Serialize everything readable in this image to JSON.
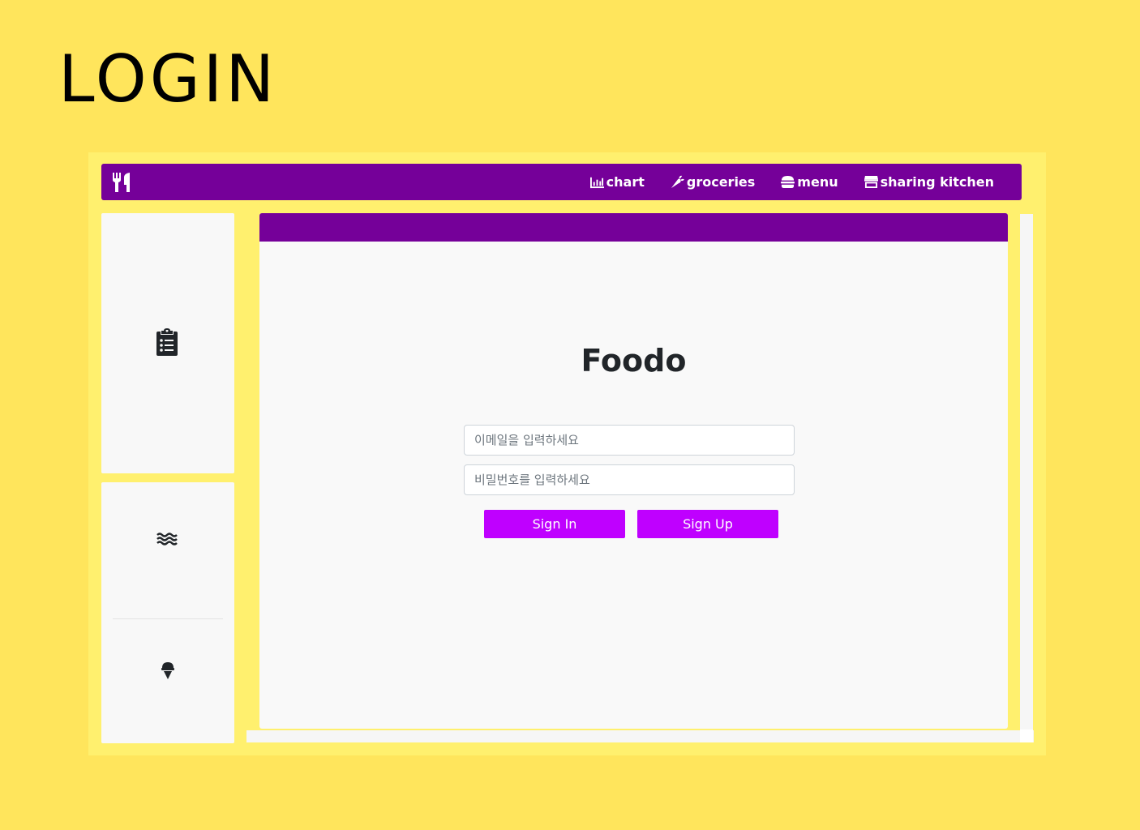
{
  "page": {
    "heading": "LOGIN"
  },
  "navbar": {
    "brand_icon": "utensils-icon",
    "links": [
      {
        "label": "chart",
        "icon": "chart-icon"
      },
      {
        "label": "groceries",
        "icon": "carrot-icon"
      },
      {
        "label": "menu",
        "icon": "burger-icon"
      },
      {
        "label": "sharing kitchen",
        "icon": "store-icon"
      }
    ]
  },
  "sidebar": {
    "items": [
      {
        "icon": "clipboard-list-icon"
      },
      {
        "icon": "water-waves-icon"
      },
      {
        "icon": "ice-cream-icon"
      }
    ]
  },
  "login": {
    "title": "Foodo",
    "email_placeholder": "이메일을 입력하세요",
    "password_placeholder": "비밀번호를 입력하세요",
    "signin_label": "Sign In",
    "signup_label": "Sign Up"
  },
  "colors": {
    "background": "#FFE55C",
    "frame": "#FFF06E",
    "primary": "#750099",
    "button": "#BF00FF",
    "card": "#F8F8F8"
  }
}
